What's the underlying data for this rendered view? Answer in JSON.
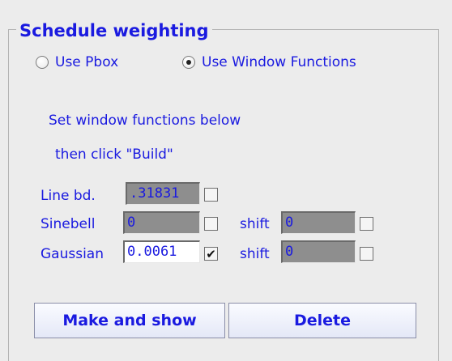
{
  "panel": {
    "title": "Schedule weighting"
  },
  "mode": {
    "options": [
      {
        "label": "Use Pbox",
        "selected": false
      },
      {
        "label": "Use Window Functions",
        "selected": true
      }
    ]
  },
  "instructions": {
    "line1": "Set window functions below",
    "line2": "then click \"Build\""
  },
  "fields": {
    "line_bd": {
      "label": "Line bd.",
      "value": ".31831",
      "checked": false,
      "enabled": false
    },
    "sinebell": {
      "label": "Sinebell",
      "value": "0",
      "checked": false,
      "enabled": false,
      "shift_label": "shift",
      "shift_value": "0",
      "shift_checked": false
    },
    "gaussian": {
      "label": "Gaussian",
      "value": "0.0061",
      "checked": true,
      "enabled": true,
      "shift_label": "shift",
      "shift_value": "0",
      "shift_checked": false
    }
  },
  "buttons": {
    "make_and_show": "Make and show",
    "delete": "Delete"
  },
  "check_mark": "✔",
  "colors": {
    "text": "#1a1ae0",
    "background": "#ececec",
    "disabled_field": "#8e8e8e"
  }
}
